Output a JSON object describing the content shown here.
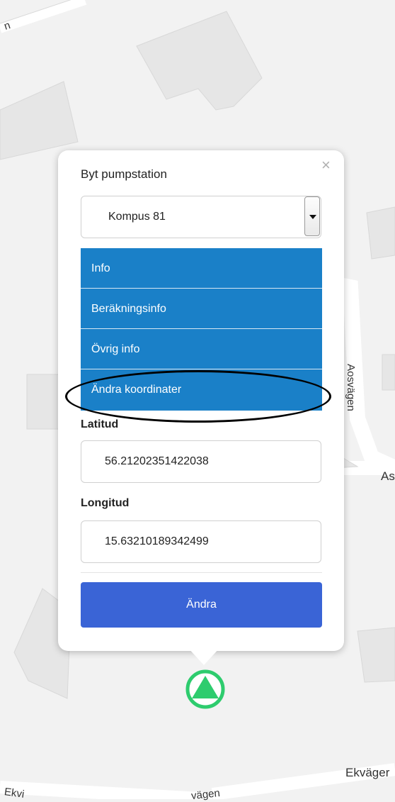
{
  "map": {
    "road_labels": [
      {
        "id": "road-top-left",
        "text": "n"
      },
      {
        "id": "road-vertical",
        "text": "Aosvägen"
      },
      {
        "id": "road-right",
        "text": "As"
      },
      {
        "id": "road-bottom-right",
        "text": "Ekväger"
      },
      {
        "id": "road-bottom-left",
        "text": "Ekvi"
      },
      {
        "id": "road-bottom-mid",
        "text": "vägen"
      }
    ]
  },
  "popup": {
    "close_label": "×",
    "title": "Byt pumpstation",
    "station_select": {
      "selected": "Kompus 81"
    },
    "menu": [
      {
        "label": "Info"
      },
      {
        "label": "Beräkningsinfo"
      },
      {
        "label": "Övrig info"
      },
      {
        "label": "Ändra koordinater"
      }
    ],
    "latitude": {
      "label": "Latitud",
      "value": "56.21202351422038"
    },
    "longitude": {
      "label": "Longitud",
      "value": "15.63210189342499"
    },
    "submit_label": "Ändra"
  },
  "colors": {
    "menu_blue": "#1a80c8",
    "button_blue": "#3a64d6",
    "marker_green": "#2ecc6e"
  },
  "icons": {
    "close": "close-icon",
    "dropdown": "chevron-down-icon",
    "marker": "pump-station-marker-icon"
  }
}
